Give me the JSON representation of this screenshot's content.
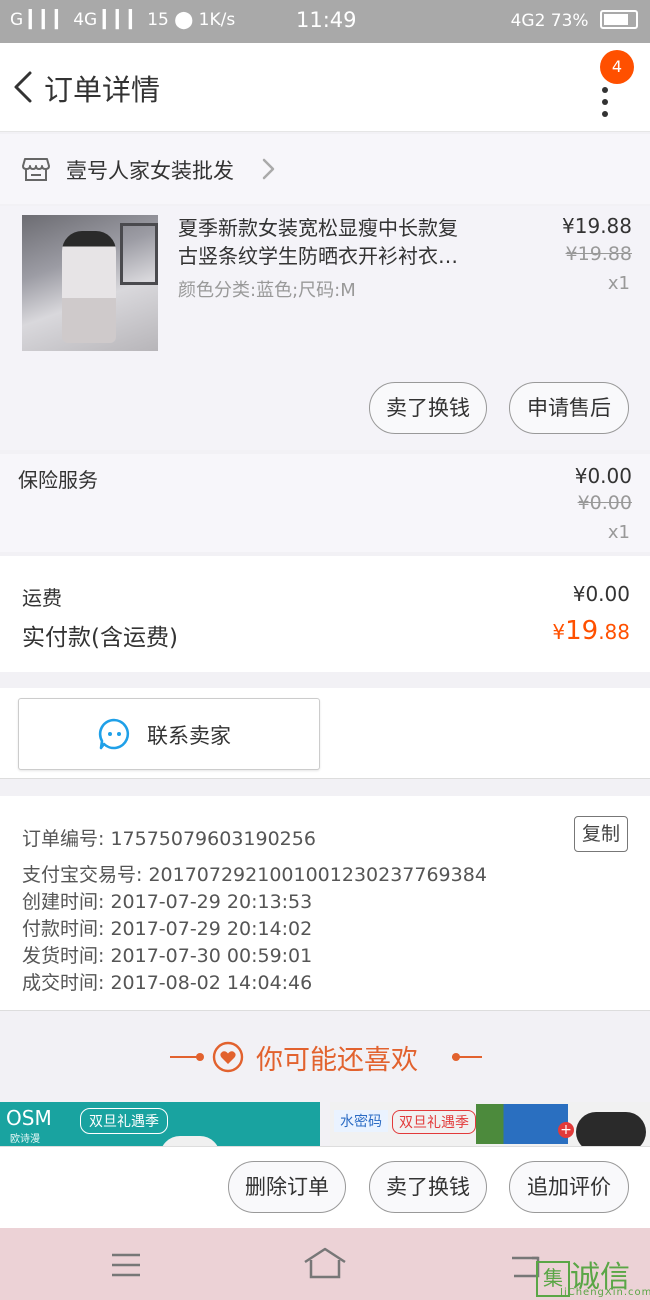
{
  "status_bar": {
    "left": "G ▎▎▎ 4G ▎▎▎ 15 ⬤ 1K/s",
    "time": "11:49",
    "network": "4G2",
    "battery": "73%"
  },
  "header": {
    "title": "订单详情",
    "badge_count": "4"
  },
  "shop": {
    "name": "壹号人家女装批发"
  },
  "product": {
    "title_line1": "夏季新款女装宽松显瘦中长款复",
    "title_line2": "古竖条纹学生防晒衣开衫衬衣…",
    "sku": "颜色分类:蓝色;尺码:M",
    "price": "¥19.88",
    "original_price": "¥19.88",
    "quantity": "x1",
    "sell_button": "卖了换钱",
    "after_sale_button": "申请售后"
  },
  "insurance": {
    "label": "保险服务",
    "price": "¥0.00",
    "original_price": "¥0.00",
    "quantity": "x1"
  },
  "totals": {
    "shipping_label": "运费",
    "shipping_value": "¥0.00",
    "paid_label": "实付款(含运费)",
    "paid_currency": "¥",
    "paid_int": "19",
    "paid_dec": ".88"
  },
  "contact": {
    "label": "联系卖家"
  },
  "order_info": {
    "rows": [
      "订单编号: 1757507960319025​6",
      "支付宝交易号: 2017072921001001230237769384",
      "创建时间: 2017-07-29  20:13:53",
      "付款时间: 2017-07-29  20:14:02",
      "发货时间: 2017-07-30  00:59:01",
      "成交时间: 2017-08-02  14:04:46"
    ],
    "copy_button": "复制"
  },
  "recommend": {
    "title": "你可能还喜欢",
    "left_banner_brand": "OSM",
    "left_banner_brand_sub": "欧诗漫",
    "left_banner_tag": "双旦礼遇季",
    "right_banner_brand": "水密码",
    "right_banner_tag": "双旦礼遇季"
  },
  "actions": {
    "delete": "删除订单",
    "sell": "卖了换钱",
    "review": "追加评价"
  },
  "watermark": {
    "char": "集",
    "text": "诚信",
    "sub": "JiChengXin.com"
  },
  "colors": {
    "accent": "#ff5000",
    "recommend": "#e2622e",
    "contact_icon": "#1fa0e8"
  }
}
